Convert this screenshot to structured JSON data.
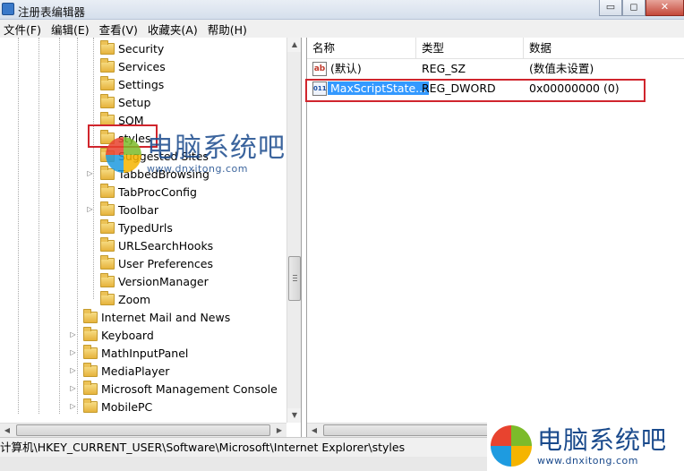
{
  "window": {
    "title": "注册表编辑器",
    "minimize": "▭",
    "maximize": "◻",
    "close": "✕"
  },
  "menu": [
    "文件(F)",
    "编辑(E)",
    "查看(V)",
    "收藏夹(A)",
    "帮助(H)"
  ],
  "tree": {
    "children": [
      {
        "label": "Security",
        "expandable": false
      },
      {
        "label": "Services",
        "expandable": false
      },
      {
        "label": "Settings",
        "expandable": false
      },
      {
        "label": "Setup",
        "expandable": false
      },
      {
        "label": "SQM",
        "expandable": false
      },
      {
        "label": "styles",
        "expandable": false,
        "highlighted": true
      },
      {
        "label": "Suggested Sites",
        "expandable": false
      },
      {
        "label": "TabbedBrowsing",
        "expandable": true
      },
      {
        "label": "TabProcConfig",
        "expandable": false
      },
      {
        "label": "Toolbar",
        "expandable": true
      },
      {
        "label": "TypedUrls",
        "expandable": false
      },
      {
        "label": "URLSearchHooks",
        "expandable": false
      },
      {
        "label": "User Preferences",
        "expandable": false
      },
      {
        "label": "VersionManager",
        "expandable": false
      },
      {
        "label": "Zoom",
        "expandable": false
      }
    ],
    "siblings": [
      {
        "label": "Internet Mail and News",
        "expandable": false
      },
      {
        "label": "Keyboard",
        "expandable": true
      },
      {
        "label": "MathInputPanel",
        "expandable": true
      },
      {
        "label": "MediaPlayer",
        "expandable": true
      },
      {
        "label": "Microsoft Management Console",
        "expandable": true
      },
      {
        "label": "MobilePC",
        "expandable": true
      }
    ]
  },
  "list": {
    "columns": [
      "名称",
      "类型",
      "数据"
    ],
    "rows": [
      {
        "name": "(默认)",
        "type": "REG_SZ",
        "data": "(数值未设置)",
        "icon": "ab"
      },
      {
        "name": "MaxScriptState...",
        "type": "REG_DWORD",
        "data": "0x00000000 (0)",
        "icon": "011",
        "selected": true
      }
    ]
  },
  "status_path": "计算机\\HKEY_CURRENT_USER\\Software\\Microsoft\\Internet Explorer\\styles",
  "watermark": {
    "title": "电脑系统吧",
    "url": "www.dnxitong.com"
  },
  "colors": {
    "highlight_red": "#d0252d",
    "selection_blue": "#3399ff"
  }
}
